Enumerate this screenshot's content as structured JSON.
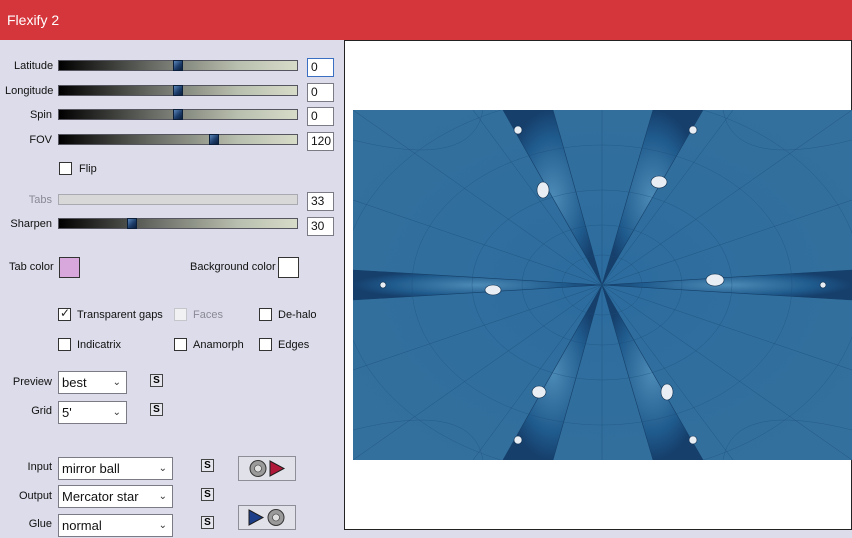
{
  "window": {
    "title": "Flexify 2"
  },
  "sliders": {
    "latitude": {
      "label": "Latitude",
      "value": "0",
      "fraction": 0.5
    },
    "longitude": {
      "label": "Longitude",
      "value": "0",
      "fraction": 0.5
    },
    "spin": {
      "label": "Spin",
      "value": "0",
      "fraction": 0.5
    },
    "fov": {
      "label": "FOV",
      "value": "120",
      "fraction": 0.66
    },
    "tabs": {
      "label": "Tabs",
      "value": "33",
      "fraction": 0.0
    },
    "sharpen": {
      "label": "Sharpen",
      "value": "30",
      "fraction": 0.3
    }
  },
  "checkboxes": {
    "flip": {
      "label": "Flip",
      "checked": false
    },
    "transparent_gaps": {
      "label": "Transparent gaps",
      "checked": true
    },
    "faces": {
      "label": "Faces",
      "checked": false
    },
    "dehalo": {
      "label": "De-halo",
      "checked": false
    },
    "indicatrix": {
      "label": "Indicatrix",
      "checked": false
    },
    "anamorph": {
      "label": "Anamorph",
      "checked": false
    },
    "edges": {
      "label": "Edges",
      "checked": false
    }
  },
  "colors": {
    "tab_color_label": "Tab color",
    "tab_color": "#d8a8dc",
    "background_color_label": "Background color",
    "background_color": "#ffffff",
    "accent": "#d5363c"
  },
  "selects": {
    "preview": {
      "label": "Preview",
      "value": "best"
    },
    "grid": {
      "label": "Grid",
      "value": "5'"
    },
    "input": {
      "label": "Input",
      "value": "mirror ball"
    },
    "output": {
      "label": "Output",
      "value": "Mercator star"
    },
    "glue": {
      "label": "Glue",
      "value": "normal"
    }
  },
  "icons": {
    "scroll_button": "s-scroll-icon",
    "input_preset": "ball-arrow-icon",
    "glue_preset": "arrow-ball-icon"
  }
}
